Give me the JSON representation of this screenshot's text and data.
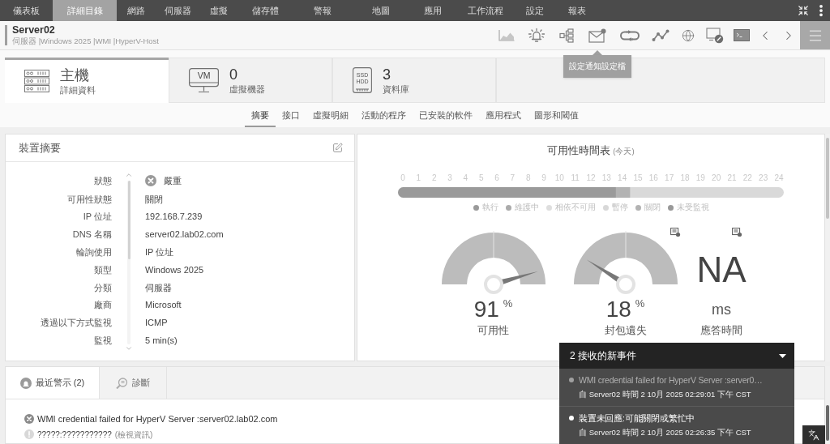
{
  "top_nav": {
    "items": [
      {
        "label": "儀表板",
        "selected": false
      },
      {
        "label": "詳細目錄",
        "selected": true
      },
      {
        "label": "網路",
        "selected": false
      },
      {
        "label": "伺服器",
        "selected": false
      },
      {
        "label": "虛擬",
        "selected": false
      },
      {
        "label": "儲存體",
        "selected": false
      },
      {
        "label": "警報",
        "selected": false
      },
      {
        "label": "地圖",
        "selected": false
      },
      {
        "label": "應用",
        "selected": false
      },
      {
        "label": "工作流程",
        "selected": false
      },
      {
        "label": "設定",
        "selected": false
      },
      {
        "label": "報表",
        "selected": false
      }
    ]
  },
  "header": {
    "title": "Server02",
    "subtitle": "伺服器 |Windows 2025 |WMI |HyperV-Host",
    "tooltip": "設定通知設定檔"
  },
  "cards": [
    {
      "kind": "host",
      "title": "主機",
      "label": "詳細資料",
      "selected": true
    },
    {
      "kind": "vm",
      "icon_lines": [
        "VM"
      ],
      "title": "0",
      "label": "虛擬機器",
      "selected": false
    },
    {
      "kind": "storage",
      "icon_lines": [
        "SSD",
        "HDD"
      ],
      "title": "3",
      "label": "資料庫",
      "selected": false
    }
  ],
  "subtabs": [
    {
      "label": "摘要",
      "selected": true
    },
    {
      "label": "接口",
      "selected": false
    },
    {
      "label": "虛擬明細",
      "selected": false
    },
    {
      "label": "活動的程序",
      "selected": false
    },
    {
      "label": "已安裝的軟件",
      "selected": false
    },
    {
      "label": "應用程式",
      "selected": false
    },
    {
      "label": "圖形和閾值",
      "selected": false
    }
  ],
  "device_summary": {
    "title": "裝置摘要",
    "rows": [
      {
        "kind": "status",
        "label": "狀態",
        "value": "嚴重"
      },
      {
        "kind": "text",
        "label": "可用性狀態",
        "value": "關閉"
      },
      {
        "kind": "text",
        "label": "IP 位址",
        "value": "192.168.7.239"
      },
      {
        "kind": "text",
        "label": "DNS 名稱",
        "value": "server02.lab02.com"
      },
      {
        "kind": "text",
        "label": "輪詢使用",
        "value": "IP 位址"
      },
      {
        "kind": "text",
        "label": "類型",
        "value": "Windows 2025"
      },
      {
        "kind": "text",
        "label": "分類",
        "value": "伺服器"
      },
      {
        "kind": "text",
        "label": "廠商",
        "value": "Microsoft"
      },
      {
        "kind": "text",
        "label": "透過以下方式監視",
        "value": "ICMP"
      },
      {
        "kind": "text",
        "label": "監視",
        "value": "5 min(s)"
      }
    ]
  },
  "availability": {
    "title": "可用性時間表",
    "title_note": "(今天)",
    "chart_data": {
      "type": "bar",
      "orientation": "horizontal",
      "stacked": true,
      "legend": "bottom",
      "xlim": [
        0,
        24
      ],
      "xticks": [
        0,
        1,
        2,
        3,
        4,
        5,
        6,
        7,
        8,
        9,
        10,
        11,
        12,
        13,
        14,
        15,
        16,
        17,
        18,
        19,
        20,
        21,
        22,
        23,
        24
      ],
      "series": [
        {
          "name": "執行",
          "color": "#9a9a9a",
          "values": [
            13.6
          ]
        },
        {
          "name": "維護中",
          "color": "#ababab",
          "values": [
            null
          ]
        },
        {
          "name": "相依不可用",
          "color": "#dedede",
          "values": [
            null
          ]
        },
        {
          "name": "暫停",
          "color": "#d8d8d8",
          "values": [
            null
          ]
        },
        {
          "name": "關閉",
          "color": "#b3b3b3",
          "values": [
            0.9
          ]
        },
        {
          "name": "未受監視",
          "color": "#999999",
          "values": [
            null
          ]
        }
      ]
    }
  },
  "metrics": [
    {
      "kind": "gauge",
      "value": "91",
      "unit": "%",
      "label": "可用性",
      "level": 0.91,
      "has_action": false
    },
    {
      "kind": "gauge",
      "value": "18",
      "unit": "%",
      "label": "封包遺失",
      "level": 0.18,
      "has_action": true
    },
    {
      "kind": "number",
      "value": "NA",
      "unit": "ms",
      "label": "應答時間",
      "has_action": true
    }
  ],
  "bottom_tabs": [
    {
      "label": "最近警示 (2)",
      "selected": true
    },
    {
      "label": "診斷",
      "selected": false
    }
  ],
  "alerts": [
    {
      "kind": "critical",
      "message": "WMI credential failed for HyperV Server :server02.lab02.com"
    },
    {
      "kind": "info",
      "message": "?????:???????????",
      "link": "(檢視資訊)"
    }
  ],
  "notifications": {
    "title": "2 接收的新事件",
    "items": [
      {
        "title": "WMI credential failed for HyperV Server :server0…",
        "meta": "自 Server02 時間 2 10月 2025 02:29:01 下午 CST",
        "read": true
      },
      {
        "title": "裝置未回應:可能關閉或繁忙中",
        "meta": "自 Server02 時間 2 10月 2025 02:26:35 下午 CST",
        "read": false
      }
    ]
  }
}
